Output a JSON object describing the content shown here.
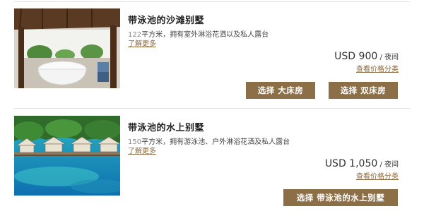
{
  "rooms": [
    {
      "title": "带泳池的沙滩别墅",
      "size_num": "122",
      "size_rest": "平方米，拥有室外淋浴花洒以及私人露台",
      "more_label": "了解更多",
      "price": "USD 900",
      "price_unit": " / 夜间",
      "price_link": "查看价格分类",
      "buttons": [
        "选择 大床房",
        "选择 双床房"
      ]
    },
    {
      "title": "带泳池的水上别墅",
      "size_num": "150",
      "size_rest": "平方米，拥有游泳池、户外淋浴花洒及私人露台",
      "more_label": "了解更多",
      "price": "USD 1,050",
      "price_unit": " / 夜间",
      "price_link": "查看价格分类",
      "buttons": [
        "选择 带泳池的水上别墅"
      ]
    }
  ],
  "colors": {
    "accent": "#8c6f46",
    "link": "#8a6a3e",
    "divider": "#e2e2e2"
  }
}
